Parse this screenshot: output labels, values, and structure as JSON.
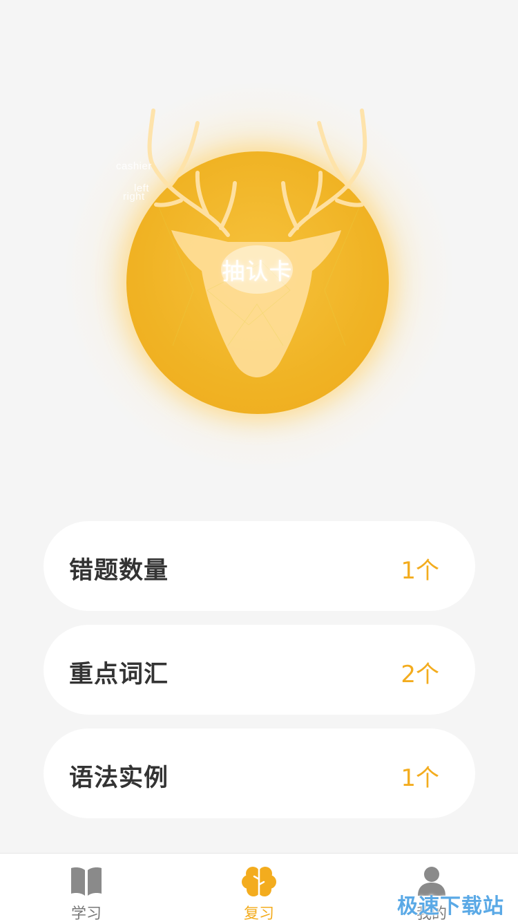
{
  "hero": {
    "title": "抽认卡",
    "labels": [
      "cashier",
      "left",
      "right"
    ]
  },
  "stats": [
    {
      "label": "错题数量",
      "count": "1个"
    },
    {
      "label": "重点词汇",
      "count": "2个"
    },
    {
      "label": "语法实例",
      "count": "1个"
    }
  ],
  "tabbar": {
    "tabs": [
      {
        "label": "学习",
        "icon": "book-icon",
        "active": false
      },
      {
        "label": "复习",
        "icon": "brain-icon",
        "active": true
      },
      {
        "label": "我的",
        "icon": "user-icon",
        "active": false
      }
    ]
  },
  "watermark": "极速下载站",
  "colors": {
    "accent": "#f3ac1e",
    "orb": "#f0b324",
    "background": "#f5f5f5",
    "inactive_tab": "#777777",
    "watermark": "#5aa9e6"
  }
}
